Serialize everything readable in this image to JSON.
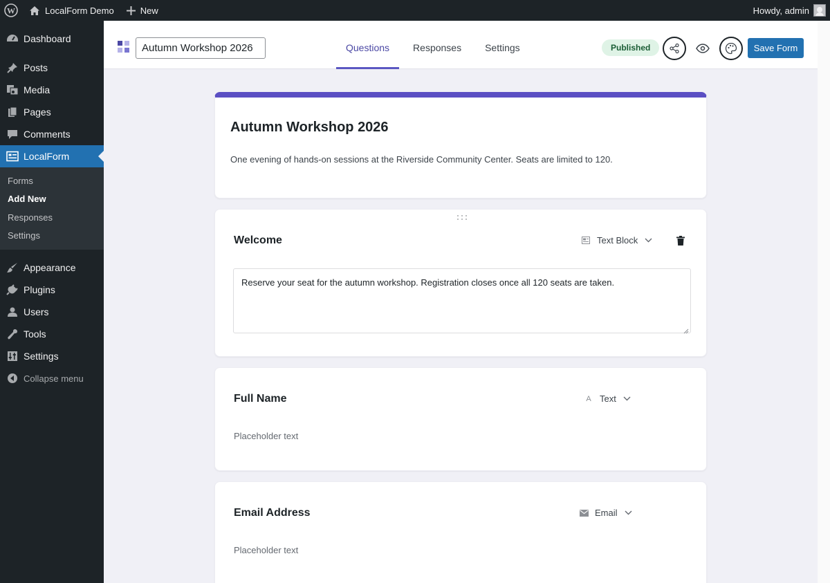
{
  "adminbar": {
    "site_name": "LocalForm Demo",
    "new_label": "New",
    "greeting": "Howdy, admin"
  },
  "sidebar": {
    "items": [
      {
        "label": "Dashboard",
        "icon": "dashboard-icon"
      },
      {
        "label": "Posts",
        "icon": "pin-icon"
      },
      {
        "label": "Media",
        "icon": "media-icon"
      },
      {
        "label": "Pages",
        "icon": "pages-icon"
      },
      {
        "label": "Comments",
        "icon": "comment-icon"
      },
      {
        "label": "LocalForm",
        "icon": "form-icon"
      }
    ],
    "submenu": [
      "Forms",
      "Add New",
      "Responses",
      "Settings"
    ],
    "items_after": [
      {
        "label": "Appearance",
        "icon": "brush-icon"
      },
      {
        "label": "Plugins",
        "icon": "plug-icon"
      },
      {
        "label": "Users",
        "icon": "user-icon"
      },
      {
        "label": "Tools",
        "icon": "wrench-icon"
      },
      {
        "label": "Settings",
        "icon": "settings-icon"
      }
    ],
    "collapse_label": "Collapse menu"
  },
  "header": {
    "form_title_value": "Autumn Workshop 2026",
    "tabs": [
      "Questions",
      "Responses",
      "Settings"
    ],
    "active_tab": "Questions",
    "status_badge": "Published",
    "save_label": "Save Form"
  },
  "form": {
    "title": "Autumn Workshop 2026",
    "description": "One evening of hands-on sessions at the Riverside Community Center. Seats are limited to 120.",
    "accent_color": "#5b4fc3",
    "questions": [
      {
        "title": "Welcome",
        "type": "Text Block",
        "type_icon": "text-block-icon",
        "body": "Reserve your seat for the autumn workshop. Registration closes once all 120 seats are taken."
      },
      {
        "title": "Full Name",
        "type": "Text",
        "type_icon": "text-icon",
        "placeholder": "Placeholder text"
      },
      {
        "title": "Email Address",
        "type": "Email",
        "type_icon": "email-icon",
        "placeholder": "Placeholder text"
      }
    ]
  }
}
